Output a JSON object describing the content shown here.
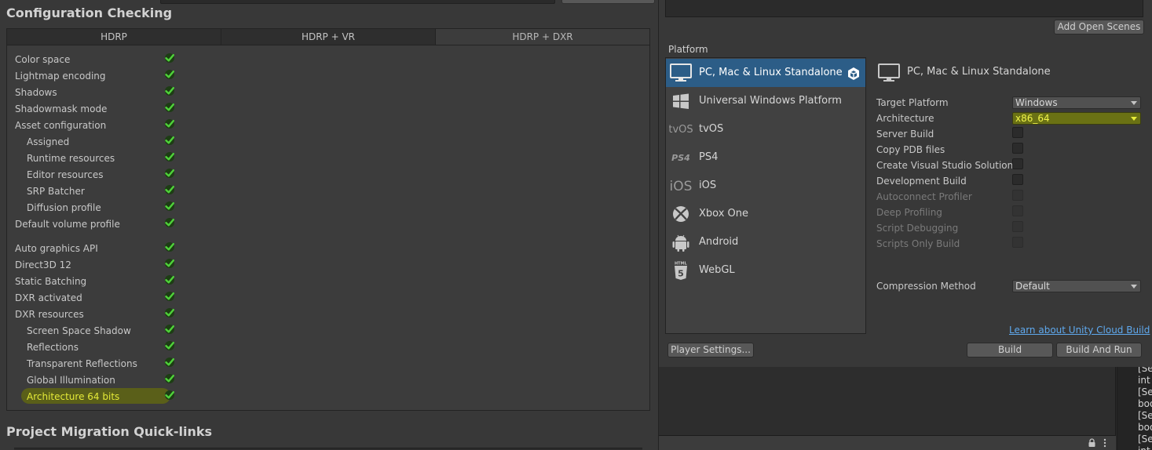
{
  "config": {
    "title": "Configuration Checking",
    "tabs": [
      "HDRP",
      "HDRP + VR",
      "HDRP + DXR"
    ],
    "active_tab": 2,
    "checks": [
      {
        "label": "Color space",
        "indent": 0,
        "ok": true
      },
      {
        "label": "Lightmap encoding",
        "indent": 0,
        "ok": true
      },
      {
        "label": "Shadows",
        "indent": 0,
        "ok": true
      },
      {
        "label": "Shadowmask mode",
        "indent": 0,
        "ok": true
      },
      {
        "label": "Asset configuration",
        "indent": 0,
        "ok": true
      },
      {
        "label": "Assigned",
        "indent": 1,
        "ok": true
      },
      {
        "label": "Runtime resources",
        "indent": 1,
        "ok": true
      },
      {
        "label": "Editor resources",
        "indent": 1,
        "ok": true
      },
      {
        "label": "SRP Batcher",
        "indent": 1,
        "ok": true
      },
      {
        "label": "Diffusion profile",
        "indent": 1,
        "ok": true
      },
      {
        "label": "Default volume profile",
        "indent": 0,
        "ok": true
      },
      {
        "label": "Auto graphics API",
        "indent": 0,
        "ok": true
      },
      {
        "label": "Direct3D 12",
        "indent": 0,
        "ok": true
      },
      {
        "label": "Static Batching",
        "indent": 0,
        "ok": true
      },
      {
        "label": "DXR activated",
        "indent": 0,
        "ok": true
      },
      {
        "label": "DXR resources",
        "indent": 0,
        "ok": true
      },
      {
        "label": "Screen Space Shadow",
        "indent": 1,
        "ok": true
      },
      {
        "label": "Reflections",
        "indent": 1,
        "ok": true
      },
      {
        "label": "Transparent Reflections",
        "indent": 1,
        "ok": true
      },
      {
        "label": "Global Illumination",
        "indent": 1,
        "ok": true
      },
      {
        "label": "Architecture 64 bits",
        "indent": 1,
        "ok": true,
        "highlighted": true
      }
    ]
  },
  "migration": {
    "title": "Project Migration Quick-links"
  },
  "build": {
    "add_open_scenes": "Add Open Scenes",
    "platform_label": "Platform",
    "platforms": [
      {
        "name": "PC, Mac & Linux Standalone",
        "icon": "monitor-icon",
        "selected": true,
        "active": true
      },
      {
        "name": "Universal Windows Platform",
        "icon": "windows-logo-icon"
      },
      {
        "name": "tvOS",
        "icon": "tvos-logo-icon",
        "icon_text": "tvOS"
      },
      {
        "name": "PS4",
        "icon": "ps4-logo-icon",
        "icon_text": "PS4"
      },
      {
        "name": "iOS",
        "icon": "ios-logo-icon",
        "icon_text": "iOS"
      },
      {
        "name": "Xbox One",
        "icon": "xbox-logo-icon"
      },
      {
        "name": "Android",
        "icon": "android-logo-icon"
      },
      {
        "name": "WebGL",
        "icon": "html5-logo-icon",
        "icon_text": "HTML"
      }
    ],
    "selected_platform_title": "PC, Mac & Linux Standalone",
    "target_platform": {
      "label": "Target Platform",
      "value": "Windows"
    },
    "architecture": {
      "label": "Architecture",
      "value": "x86_64",
      "highlighted": true
    },
    "options": [
      {
        "label": "Server Build",
        "checked": false,
        "enabled": true
      },
      {
        "label": "Copy PDB files",
        "checked": false,
        "enabled": true
      },
      {
        "label": "Create Visual Studio Solution",
        "checked": false,
        "enabled": true
      },
      {
        "label": "Development Build",
        "checked": false,
        "enabled": true
      },
      {
        "label": "Autoconnect Profiler",
        "checked": false,
        "enabled": false
      },
      {
        "label": "Deep Profiling",
        "checked": false,
        "enabled": false
      },
      {
        "label": "Script Debugging",
        "checked": false,
        "enabled": false
      },
      {
        "label": "Scripts Only Build",
        "checked": false,
        "enabled": false
      }
    ],
    "compression": {
      "label": "Compression Method",
      "value": "Default"
    },
    "cloud_link": "Learn about Unity Cloud Build",
    "player_settings": "Player Settings...",
    "build": "Build",
    "build_and_run": "Build And Run"
  },
  "code_snippets": [
    "[Se",
    "int",
    "[Se",
    "boo",
    "[Se",
    "boo",
    "[Se",
    "int"
  ],
  "colors": {
    "panel_bg": "#383838",
    "selection_blue": "#2c5d87",
    "check_green": "#4fd13a",
    "highlight_yellow": "#e4ea38",
    "link_blue": "#5fa9ee"
  }
}
